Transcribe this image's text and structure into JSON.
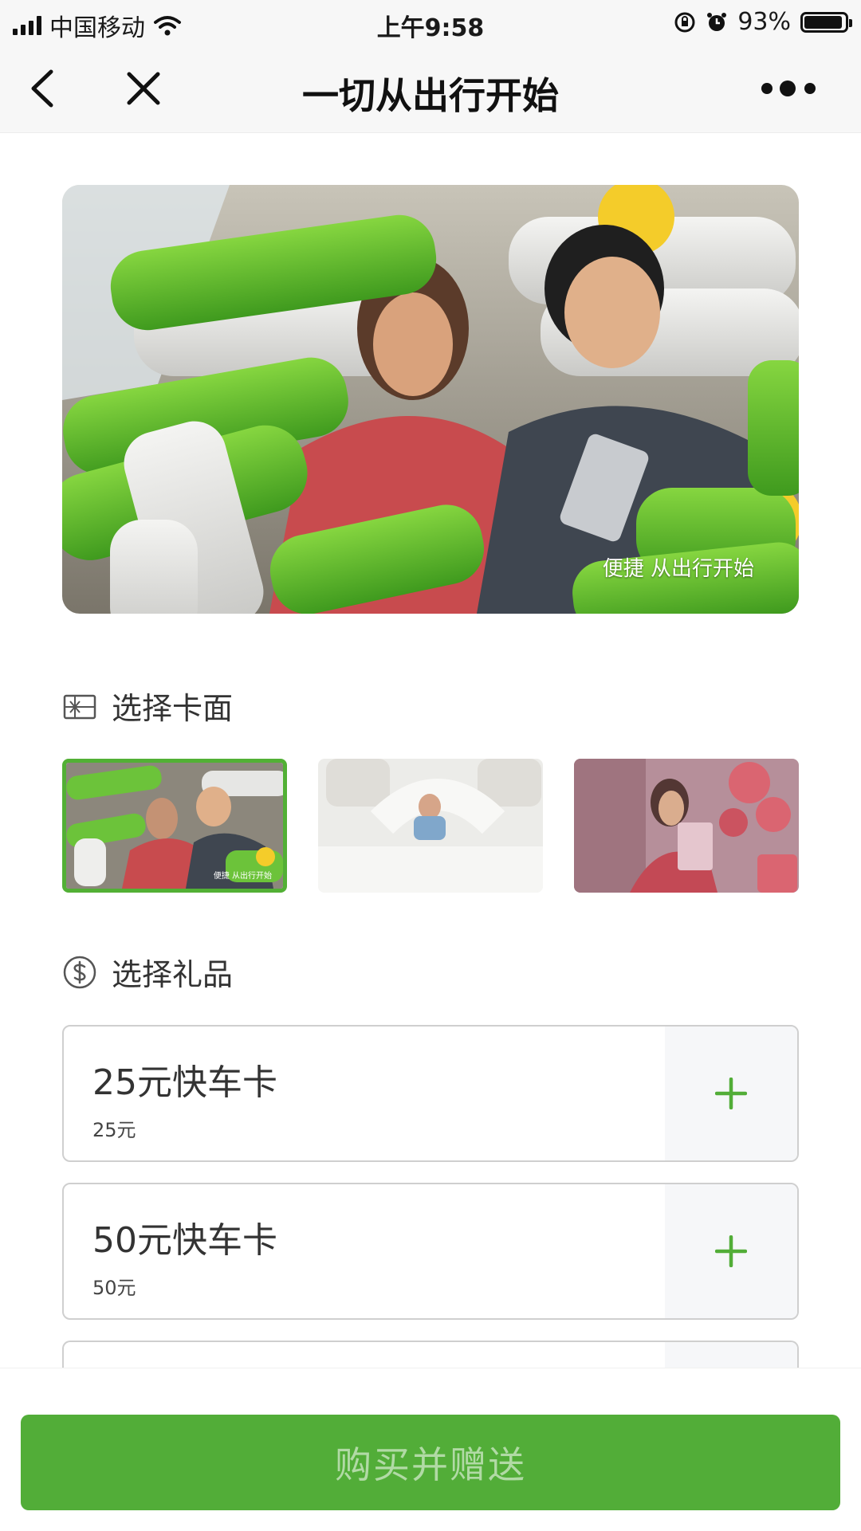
{
  "status_bar": {
    "carrier": "中国移动",
    "time": "上午9:58",
    "battery": "93%",
    "battery_level": 0.93
  },
  "nav": {
    "title": "一切从出行开始"
  },
  "hero": {
    "caption": "便捷 从出行开始"
  },
  "sections": {
    "card_title": "选择卡面",
    "gift_title": "选择礼品"
  },
  "gifts": [
    {
      "name": "25元快车卡",
      "price": "25元"
    },
    {
      "name": "50元快车卡",
      "price": "50元"
    }
  ],
  "bottom": {
    "buy_label": "购买并赠送"
  },
  "colors": {
    "accent": "#52ad38",
    "selected_border": "#52b035"
  },
  "icons": {
    "back": "chevron-left-icon",
    "close": "close-icon",
    "more": "more-dots-icon",
    "card": "gift-card-icon",
    "gift": "dollar-icon",
    "add": "plus-icon"
  }
}
